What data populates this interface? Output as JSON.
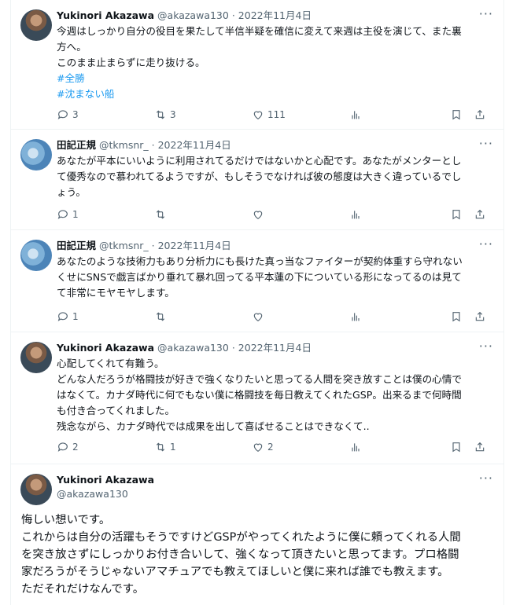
{
  "tweets": [
    {
      "name": "Yukinori Akazawa",
      "handle": "@akazawa130",
      "date": "2022年11月4日",
      "lines": [
        "今週はしっかり自分の役目を果たして半信半疑を確信に変えて来週は主役を演じて、また裏",
        "方へ。",
        "このまま止まらずに走り抜ける。"
      ],
      "hashtags": [
        "#全勝",
        "#沈まない船"
      ],
      "replies": "3",
      "retweets": "3",
      "likes": "111"
    },
    {
      "name": "田記正規",
      "handle": "@tkmsnr_",
      "date": "2022年11月4日",
      "lines": [
        "あなたが平本にいいように利用されてるだけではないかと心配です。あなたがメンターとし",
        "て優秀なので慕われてるようですが、もしそうでなければ彼の態度は大きく違っているでし",
        "ょう。"
      ],
      "replies": "1",
      "retweets": "",
      "likes": ""
    },
    {
      "name": "田記正規",
      "handle": "@tkmsnr_",
      "date": "2022年11月4日",
      "lines": [
        "あなたのような技術力もあり分析力にも長けた真っ当なファイターが契約体重すら守れない",
        "くせにSNSで戯言ばかり垂れて暴れ回ってる平本蓮の下についている形になってるのは見て",
        "て非常にモヤモヤします。"
      ],
      "replies": "1",
      "retweets": "",
      "likes": ""
    },
    {
      "name": "Yukinori Akazawa",
      "handle": "@akazawa130",
      "date": "2022年11月4日",
      "lines": [
        "心配してくれて有難う。",
        "どんな人だろうが格闘技が好きで強くなりたいと思ってる人間を突き放すことは僕の心情で",
        "はなくて。カナダ時代に何でもない僕に格闘技を毎日教えてくれたGSP。出来るまで何時間",
        "も付き合ってくれました。",
        "残念ながら、カナダ時代では成果を出して喜ばせることはできなくて.."
      ],
      "replies": "2",
      "retweets": "1",
      "likes": "2"
    }
  ],
  "main_tweet": {
    "name": "Yukinori Akazawa",
    "handle": "@akazawa130",
    "lines": [
      "悔しい想いです。",
      "これからは自分の活躍もそうですけどGSPがやってくれたように僕に頼ってくれる人間",
      "を突き放さずにしっかりお付き合いして、強くなって頂きたいと思ってます。プロ格闘",
      "家だろうがそうじゃないアマチュアでも教えてほしいと僕に来れば誰でも教えます。",
      "ただそれだけなんです。"
    ]
  },
  "ui": {
    "dot": "·",
    "more": "···"
  },
  "icons": [
    "more-icon",
    "reply-icon",
    "retweet-icon",
    "like-icon",
    "views-icon",
    "bookmark-icon",
    "share-icon"
  ],
  "colors": {
    "text": "#0f1419",
    "muted": "#536471",
    "link": "#1d9bf0",
    "border": "#eff3f4"
  }
}
